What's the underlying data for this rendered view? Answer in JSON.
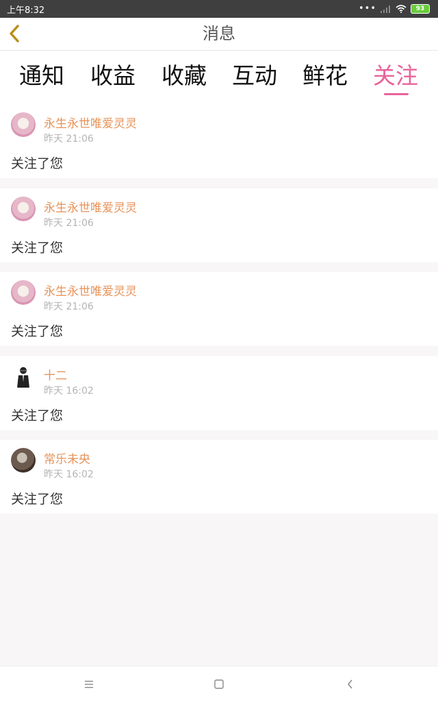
{
  "status": {
    "time": "上午8:32",
    "battery": "93"
  },
  "header": {
    "title": "消息"
  },
  "tabs": [
    {
      "label": "通知"
    },
    {
      "label": "收益"
    },
    {
      "label": "收藏"
    },
    {
      "label": "互动"
    },
    {
      "label": "鲜花"
    },
    {
      "label": "关注"
    }
  ],
  "active_tab": "关注",
  "colors": {
    "accent": "#e8639a",
    "username": "#e6935a",
    "back_icon": "#b8901a"
  },
  "items": [
    {
      "name": "永生永世唯爱灵灵",
      "time": "昨天 21:06",
      "message": "关注了您",
      "avatar": "pink-avatar"
    },
    {
      "name": "永生永世唯爱灵灵",
      "time": "昨天 21:06",
      "message": "关注了您",
      "avatar": "pink-avatar"
    },
    {
      "name": "永生永世唯爱灵灵",
      "time": "昨天 21:06",
      "message": "关注了您",
      "avatar": "pink-avatar"
    },
    {
      "name": "十二",
      "time": "昨天 16:02",
      "message": "关注了您",
      "avatar": "figure-avatar"
    },
    {
      "name": "常乐未央",
      "time": "昨天 16:02",
      "message": "关注了您",
      "avatar": "dark-avatar"
    }
  ]
}
